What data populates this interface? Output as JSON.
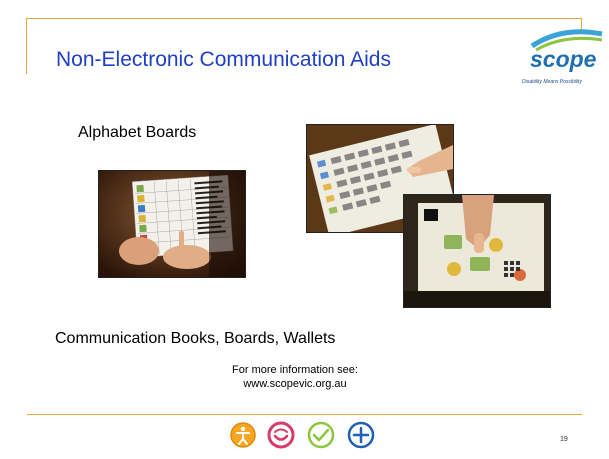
{
  "slide": {
    "title": "Non-Electronic Communication Aids",
    "alphabet_label": "Alphabet Boards",
    "comm_label": "Communication Books, Boards, Wallets",
    "info_line1": "For more information see:",
    "info_line2": "www.scopevic.org.au",
    "page_number": "19"
  },
  "logo": {
    "word": "scope",
    "tagline": "Disability Means Possibility"
  },
  "colors": {
    "title": "#1f3fc7",
    "frame": "#e3a83a",
    "icon_orange": "#f5a623",
    "icon_red": "#d93a6a",
    "icon_green": "#8cc63f",
    "icon_blue": "#1f5fb4"
  },
  "footer_icons": [
    {
      "name": "person-icon"
    },
    {
      "name": "smile-icon"
    },
    {
      "name": "check-icon"
    },
    {
      "name": "plus-icon"
    }
  ]
}
